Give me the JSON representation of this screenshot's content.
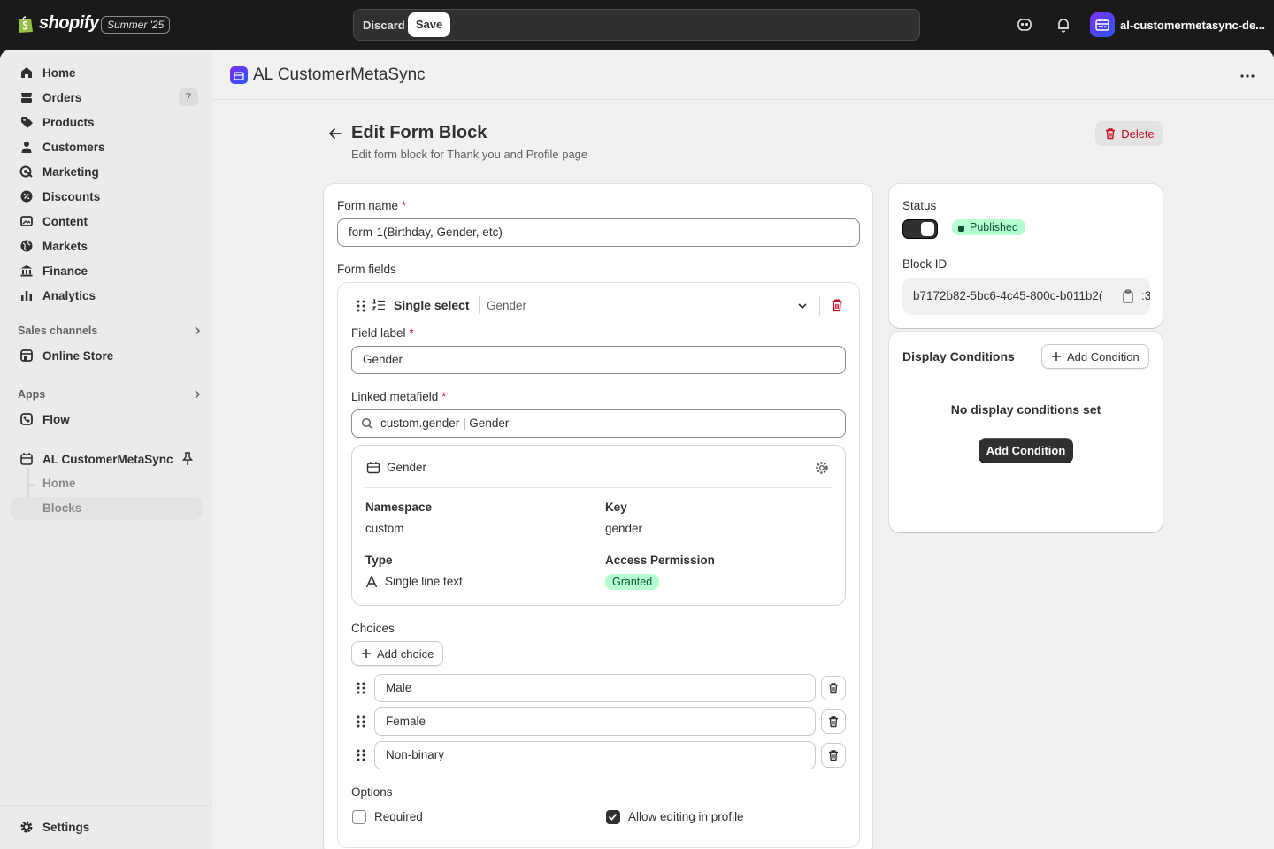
{
  "topbar": {
    "logo_text": "shopify",
    "edition": "Summer '25",
    "discard_label": "Discard",
    "save_label": "Save",
    "store_name": "al-customermetasync-de..."
  },
  "sidebar": {
    "items": [
      {
        "label": "Home",
        "icon": "home-icon"
      },
      {
        "label": "Orders",
        "icon": "orders-icon",
        "badge": "7"
      },
      {
        "label": "Products",
        "icon": "tag-icon"
      },
      {
        "label": "Customers",
        "icon": "person-icon"
      },
      {
        "label": "Marketing",
        "icon": "target-icon"
      },
      {
        "label": "Discounts",
        "icon": "discount-icon"
      },
      {
        "label": "Content",
        "icon": "image-icon"
      },
      {
        "label": "Markets",
        "icon": "globe-icon"
      },
      {
        "label": "Finance",
        "icon": "bank-icon"
      },
      {
        "label": "Analytics",
        "icon": "chart-icon"
      }
    ],
    "sales_channels_heading": "Sales channels",
    "online_store": "Online Store",
    "apps_heading": "Apps",
    "flow": "Flow",
    "app_name": "AL CustomerMetaSync",
    "app_sub_items": [
      "Home",
      "Blocks"
    ],
    "settings": "Settings"
  },
  "app_header": {
    "title": "AL CustomerMetaSync"
  },
  "page": {
    "title": "Edit Form Block",
    "subtitle": "Edit form block for Thank you and Profile page",
    "delete_label": "Delete"
  },
  "form": {
    "form_name_label": "Form name",
    "required_mark": "*",
    "form_name_value": "form-1(Birthday, Gender, etc)",
    "form_fields_label": "Form fields",
    "field": {
      "type": "Single select",
      "name": "Gender",
      "field_label_label": "Field label",
      "field_label_value": "Gender",
      "linked_metafield_label": "Linked metafield",
      "linked_metafield_value": "custom.gender | Gender",
      "metafield_card": {
        "title": "Gender",
        "namespace_label": "Namespace",
        "namespace_value": "custom",
        "key_label": "Key",
        "key_value": "gender",
        "type_label": "Type",
        "type_value": "Single line text",
        "access_label": "Access Permission",
        "access_value": "Granted"
      },
      "choices_label": "Choices",
      "add_choice_label": "Add choice",
      "choices": [
        "Male",
        "Female",
        "Non-binary"
      ],
      "options_label": "Options",
      "required_label": "Required",
      "required_checked": false,
      "allow_editing_label": "Allow editing in profile",
      "allow_editing_checked": true
    }
  },
  "status_card": {
    "status_label": "Status",
    "status_value": "Published",
    "toggle_on": true,
    "block_id_label": "Block ID",
    "block_id_value": "b7172b82-5bc6-4c45-800c-b011b2("
  },
  "conditions_card": {
    "title": "Display Conditions",
    "add_condition_label": "Add Condition",
    "empty_text": "No display conditions set",
    "empty_button_label": "Add Condition"
  },
  "colors": {
    "accent_green": "#b4fed2",
    "critical": "#c70a24",
    "dark": "#303030"
  }
}
